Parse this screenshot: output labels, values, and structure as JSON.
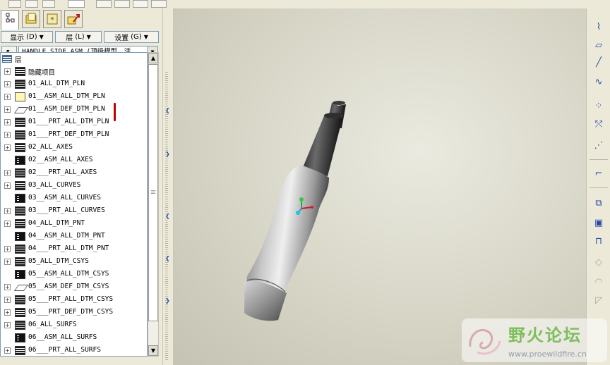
{
  "menus": {
    "show_label": "显示",
    "show_key": "(D)",
    "layer_label": "层",
    "layer_key": "(L)",
    "settings_label": "设置",
    "settings_key": "(G)"
  },
  "model_path": "HANDLE_SIDE.ASM (顶级模型，活",
  "tree": {
    "root_label": "层",
    "items": [
      {
        "label": "隐藏项目",
        "icon": "layers-icon"
      },
      {
        "label": "01_ALL_DTM_PLN",
        "icon": "layers-icon"
      },
      {
        "label": "01__ASM_ALL_DTM_PLN",
        "icon": "selected-layer-icon"
      },
      {
        "label": "01__ASM_DEF_DTM_PLN",
        "icon": "datum-plane-icon"
      },
      {
        "label": "01___PRT_ALL_DTM_PLN",
        "icon": "layers-icon"
      },
      {
        "label": "01___PRT_DEF_DTM_PLN",
        "icon": "layers-icon"
      },
      {
        "label": "02_ALL_AXES",
        "icon": "layers-icon"
      },
      {
        "label": "02__ASM_ALL_AXES",
        "icon": "layer-doc-icon"
      },
      {
        "label": "02___PRT_ALL_AXES",
        "icon": "layers-icon"
      },
      {
        "label": "03_ALL_CURVES",
        "icon": "layers-icon"
      },
      {
        "label": "03__ASM_ALL_CURVES",
        "icon": "layer-doc-icon"
      },
      {
        "label": "03___PRT_ALL_CURVES",
        "icon": "layers-icon"
      },
      {
        "label": "04_ALL_DTM_PNT",
        "icon": "layers-icon"
      },
      {
        "label": "04__ASM_ALL_DTM_PNT",
        "icon": "layer-doc-icon"
      },
      {
        "label": "04___PRT_ALL_DTM_PNT",
        "icon": "layers-icon"
      },
      {
        "label": "05_ALL_DTM_CSYS",
        "icon": "layers-icon"
      },
      {
        "label": "05__ASM_ALL_DTM_CSYS",
        "icon": "layer-doc-icon"
      },
      {
        "label": "05__ASM_DEF_DTM_CSYS",
        "icon": "datum-plane-icon"
      },
      {
        "label": "05___PRT_ALL_DTM_CSYS",
        "icon": "layers-icon"
      },
      {
        "label": "05___PRT_DEF_DTM_CSYS",
        "icon": "layers-icon"
      },
      {
        "label": "06_ALL_SURFS",
        "icon": "layers-icon"
      },
      {
        "label": "06__ASM_ALL_SURFS",
        "icon": "layer-doc-icon"
      },
      {
        "label": "06___PRT_ALL_SURFS",
        "icon": "layers-icon"
      }
    ]
  },
  "watermark": {
    "title": "野火论坛",
    "url": "www.proewildfire.cn"
  },
  "colors": {
    "accent_blue": "#2b4aa8",
    "marker_red": "#c00000",
    "watermark_green": "#7fbe5c"
  }
}
